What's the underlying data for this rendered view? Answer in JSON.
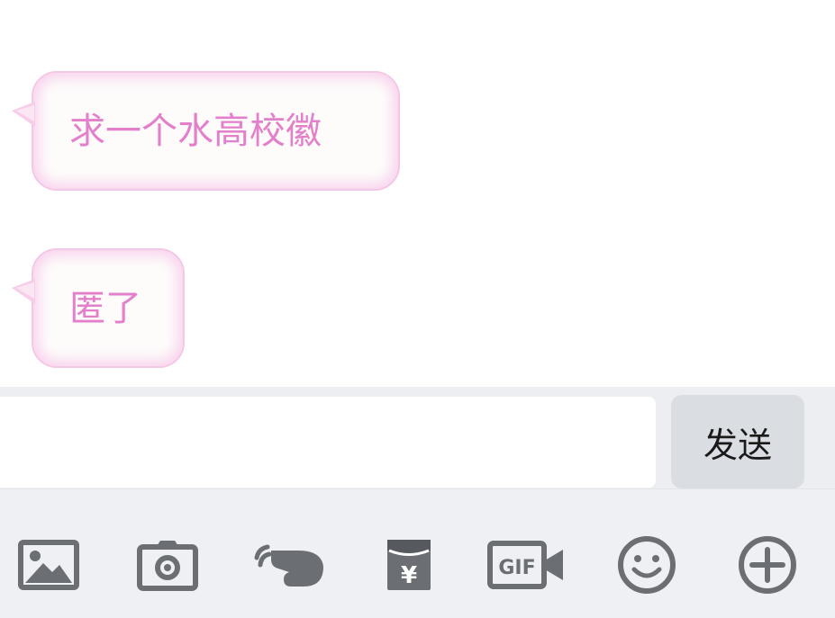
{
  "messages": [
    {
      "text": "求一个水高校徽"
    },
    {
      "text": "匿了"
    }
  ],
  "input": {
    "value": "",
    "placeholder": ""
  },
  "send_button": {
    "label": "发送"
  },
  "toolbar": {
    "icons": [
      "image-icon",
      "camera-icon",
      "poke-hand-icon",
      "red-packet-icon",
      "gif-icon",
      "emoji-icon",
      "plus-icon"
    ],
    "red_packet_glyph": "¥",
    "gif_label": "GIF"
  },
  "colors": {
    "bubble_text": "#e47fcb",
    "bubble_border": "#f4c7e6",
    "icon_gray": "#6b6f74",
    "send_bg": "#dadde1",
    "bar_bg": "#eceef1"
  }
}
